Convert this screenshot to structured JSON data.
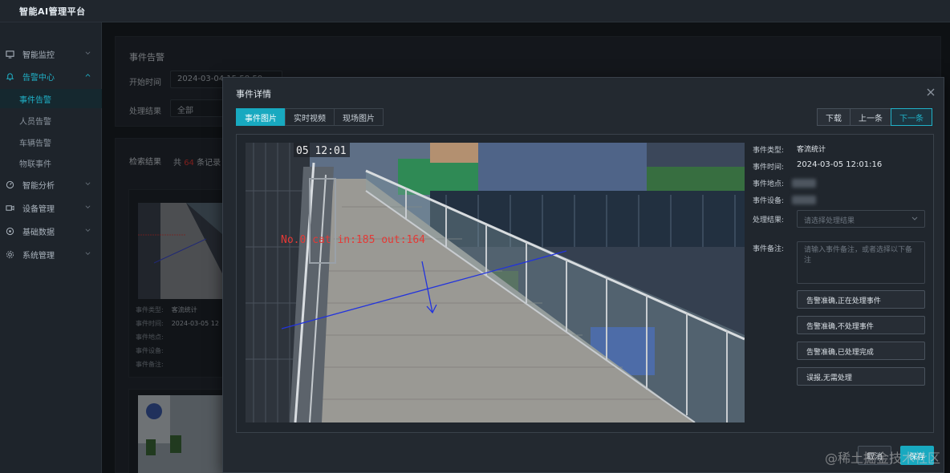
{
  "app": {
    "title": "智能AI管理平台"
  },
  "sidebar": {
    "items": [
      {
        "label": "智能监控",
        "icon": "monitor-icon"
      },
      {
        "label": "告警中心",
        "icon": "bell-icon"
      },
      {
        "label": "智能分析",
        "icon": "analysis-icon"
      },
      {
        "label": "设备管理",
        "icon": "camera-icon"
      },
      {
        "label": "基础数据",
        "icon": "database-icon"
      },
      {
        "label": "系统管理",
        "icon": "gear-icon"
      }
    ],
    "sub_items": [
      "事件告警",
      "人员告警",
      "车辆告警",
      "物联事件"
    ]
  },
  "filter": {
    "title": "事件告警",
    "start_time_label": "开始时间",
    "start_time_value": "2024-03-04 15:58:59",
    "result_label": "处理结果",
    "result_value": "全部"
  },
  "results": {
    "title": "检索结果",
    "count_prefix": "共",
    "count": "64",
    "count_suffix": "条记录",
    "card": {
      "type_label": "事件类型:",
      "type_value": "客流统计",
      "time_label": "事件时间:",
      "time_value": "2024-03-05 12",
      "place_label": "事件地点:",
      "device_label": "事件设备:",
      "note_label": "事件备注:"
    }
  },
  "modal": {
    "title": "事件详情",
    "tabs": [
      "事件图片",
      "实时视频",
      "现场图片"
    ],
    "actions": {
      "download": "下载",
      "prev": "上一条",
      "next": "下一条"
    },
    "image_overlay": {
      "timestamp": "05 12:01",
      "count_text": "No.0 cat in:185 out:164"
    },
    "details": {
      "type_label": "事件类型:",
      "type_value": "客流统计",
      "time_label": "事件时间:",
      "time_value": "2024-03-05 12:01:16",
      "place_label": "事件地点:",
      "device_label": "事件设备:",
      "result_label": "处理结果:",
      "result_placeholder": "请选择处理结果",
      "note_label": "事件备注:",
      "note_placeholder": "请输入事件备注，或者选择以下备注"
    },
    "quick_notes": [
      "告警准确,正在处理事件",
      "告警准确,不处理事件",
      "告警准确,已处理完成",
      "误报,无需处理"
    ],
    "footer": {
      "cancel": "取消",
      "save": "保存"
    }
  },
  "watermark": "@稀土掘金技术社区",
  "colors": {
    "accent": "#18a9c0",
    "background": "#1b2026",
    "alert_red": "#e53935"
  }
}
